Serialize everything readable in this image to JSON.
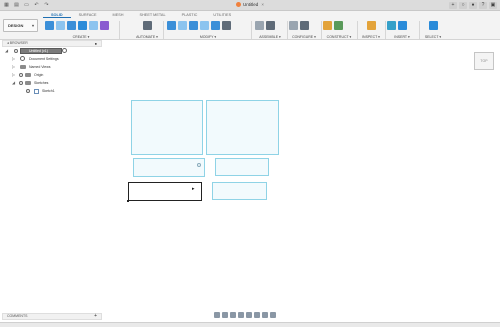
{
  "window": {
    "title": "Untitled",
    "close_glyph": "×"
  },
  "titlebar_right": {
    "glyphs": [
      "+",
      "○",
      "●",
      "?",
      "▣"
    ]
  },
  "workspace": {
    "label": "DESIGN",
    "dropdown_glyph": "▾"
  },
  "tabs": [
    {
      "label": "SOLID",
      "active": true
    },
    {
      "label": "SURFACE",
      "active": false
    },
    {
      "label": "MESH",
      "active": false
    },
    {
      "label": "SHEET METAL",
      "active": false
    },
    {
      "label": "PLASTIC",
      "active": false
    },
    {
      "label": "UTILITIES",
      "active": false
    }
  ],
  "groups": [
    {
      "label": "CREATE ▾"
    },
    {
      "label": "AUTOMATE ▾"
    },
    {
      "label": "MODIFY ▾"
    },
    {
      "label": "ASSEMBLE ▾"
    },
    {
      "label": "CONFIGURE ▾"
    },
    {
      "label": "CONSTRUCT ▾"
    },
    {
      "label": "INSPECT ▾"
    },
    {
      "label": "INSERT ▾"
    },
    {
      "label": "SELECT ▾"
    }
  ],
  "browser": {
    "title": "BROWSER",
    "pin_glyph": "●",
    "collapse_glyph": "◂",
    "items": [
      {
        "label": "Untitled (v1)"
      },
      {
        "label": "Document Settings"
      },
      {
        "label": "Named Views"
      },
      {
        "label": "Origin"
      },
      {
        "label": "Sketches"
      },
      {
        "label": "Sketch1"
      }
    ]
  },
  "viewcube": {
    "label": "TOP"
  },
  "comments": {
    "title": "COMMENTS",
    "add_glyph": "+"
  },
  "sketch": {
    "cursor_glyph": "▸"
  },
  "colors": {
    "accent": "#1f6fb2",
    "sketch_line": "#8fd3e6",
    "selected_line": "#222222",
    "ribbon_bg": "#f3f3f3"
  }
}
